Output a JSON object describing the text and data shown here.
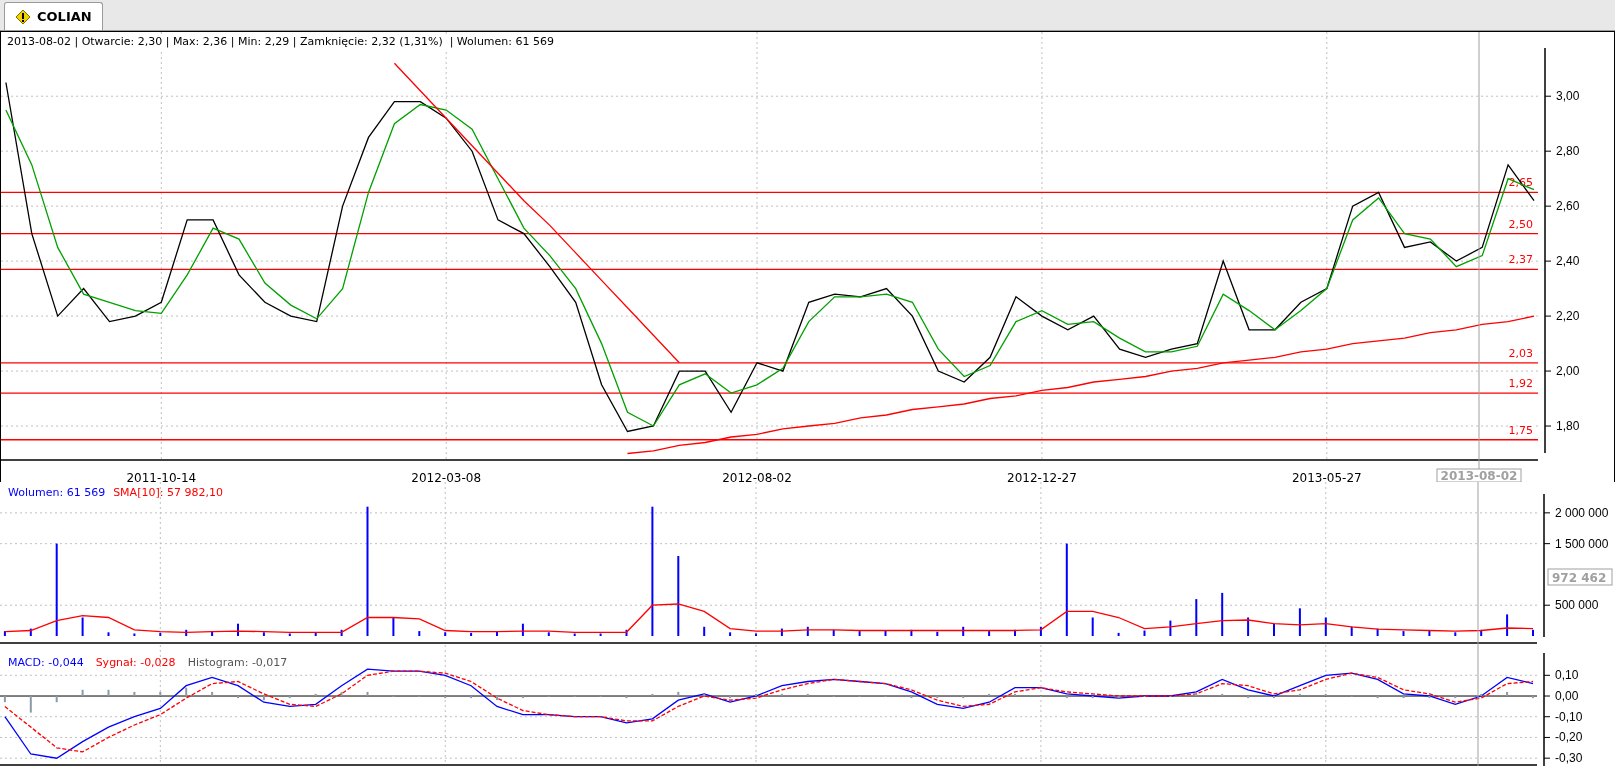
{
  "tab": {
    "label": "COLIAN",
    "selected": true
  },
  "info_line": "2013-08-02 | Otwarcie: 2,30 | Max: 2,36 | Min: 2,29 | Zamknięcie: 2,32 (1,31%)  | Wolumen: 61 569",
  "cursor": {
    "date_label": "2013-08-02",
    "volume_label": "972 462"
  },
  "price_chart": {
    "chart_data": {
      "type": "line",
      "grid": true,
      "categories": [
        null,
        null,
        null,
        null,
        null,
        null,
        "2011-10-14",
        null,
        null,
        null,
        null,
        null,
        null,
        null,
        null,
        null,
        null,
        "2012-03-08",
        null,
        null,
        null,
        null,
        null,
        null,
        null,
        null,
        null,
        null,
        null,
        "2012-08-02",
        null,
        null,
        null,
        null,
        null,
        null,
        null,
        null,
        null,
        null,
        "2012-12-27",
        null,
        null,
        null,
        null,
        null,
        null,
        null,
        null,
        null,
        null,
        "2013-05-27",
        null,
        null,
        null,
        null,
        null,
        null,
        null,
        null
      ],
      "ylim": [
        1.68,
        3.23
      ],
      "yticks": [
        {
          "value": 1.8,
          "label": "1,80"
        },
        {
          "value": 2.0,
          "label": "2,00"
        },
        {
          "value": 2.2,
          "label": "2,20"
        },
        {
          "value": 2.4,
          "label": "2,40"
        },
        {
          "value": 2.6,
          "label": "2,60"
        },
        {
          "value": 2.8,
          "label": "2,80"
        },
        {
          "value": 3.0,
          "label": "3,00"
        }
      ],
      "series": [
        {
          "color": "#000000",
          "values": [
            3.05,
            2.5,
            2.2,
            2.3,
            2.18,
            2.2,
            2.25,
            2.55,
            2.55,
            2.35,
            2.25,
            2.2,
            2.18,
            2.6,
            2.85,
            2.98,
            2.98,
            2.92,
            2.8,
            2.55,
            2.5,
            2.38,
            2.25,
            1.95,
            1.78,
            1.8,
            2.0,
            2.0,
            1.85,
            2.03,
            2.0,
            2.25,
            2.28,
            2.27,
            2.3,
            2.2,
            2.0,
            1.96,
            2.05,
            2.27,
            2.2,
            2.15,
            2.2,
            2.08,
            2.05,
            2.08,
            2.1,
            2.4,
            2.15,
            2.15,
            2.25,
            2.3,
            2.6,
            2.65,
            2.45,
            2.47,
            2.4,
            2.45,
            2.75,
            2.62
          ]
        },
        {
          "color": "#00a000",
          "values": [
            2.95,
            2.75,
            2.45,
            2.28,
            2.25,
            2.22,
            2.21,
            2.35,
            2.52,
            2.48,
            2.32,
            2.24,
            2.19,
            2.3,
            2.65,
            2.9,
            2.97,
            2.95,
            2.88,
            2.7,
            2.52,
            2.42,
            2.3,
            2.1,
            1.85,
            1.8,
            1.95,
            1.99,
            1.92,
            1.95,
            2.01,
            2.18,
            2.27,
            2.27,
            2.28,
            2.25,
            2.08,
            1.98,
            2.02,
            2.18,
            2.22,
            2.17,
            2.18,
            2.12,
            2.07,
            2.07,
            2.09,
            2.28,
            2.22,
            2.15,
            2.22,
            2.3,
            2.55,
            2.63,
            2.5,
            2.48,
            2.38,
            2.42,
            2.7,
            2.66
          ]
        },
        {
          "color": "#ff0000",
          "values": [
            null,
            null,
            null,
            null,
            null,
            null,
            null,
            null,
            null,
            null,
            null,
            null,
            null,
            null,
            null,
            3.12,
            3.02,
            2.92,
            2.82,
            2.72,
            2.62,
            2.53,
            2.43,
            2.33,
            2.23,
            2.13,
            2.03,
            null,
            null,
            null,
            null,
            null,
            null,
            null,
            null,
            null,
            null,
            null,
            null,
            null,
            null,
            null,
            null,
            null,
            null,
            null,
            null,
            null,
            null,
            null,
            null,
            null,
            null,
            null,
            null,
            null,
            null,
            null,
            null,
            null
          ]
        },
        {
          "color": "#ff0000",
          "values": [
            null,
            null,
            null,
            null,
            null,
            null,
            null,
            null,
            null,
            null,
            null,
            null,
            null,
            null,
            null,
            null,
            null,
            null,
            null,
            null,
            null,
            null,
            null,
            null,
            1.7,
            1.71,
            1.73,
            1.74,
            1.76,
            1.77,
            1.79,
            1.8,
            1.81,
            1.83,
            1.84,
            1.86,
            1.87,
            1.88,
            1.9,
            1.91,
            1.93,
            1.94,
            1.96,
            1.97,
            1.98,
            2.0,
            2.01,
            2.03,
            2.04,
            2.05,
            2.07,
            2.08,
            2.1,
            2.11,
            2.12,
            2.14,
            2.15,
            2.17,
            2.18,
            2.2
          ]
        }
      ],
      "ref_lines": [
        {
          "axis": "y",
          "value": 2.65,
          "label": "2,65"
        },
        {
          "axis": "y",
          "value": 2.5,
          "label": "2,50"
        },
        {
          "axis": "y",
          "value": 2.37,
          "label": "2,37"
        },
        {
          "axis": "y",
          "value": 2.03,
          "label": "2,03"
        },
        {
          "axis": "y",
          "value": 1.92,
          "label": "1,92"
        },
        {
          "axis": "y",
          "value": 1.75,
          "label": "1,75"
        }
      ]
    }
  },
  "volume_chart": {
    "legend": [
      {
        "text": "Wolumen: 61 569",
        "color": "#0000ff"
      },
      {
        "text": "SMA[10]: 57 982,10",
        "color": "#ff0000"
      }
    ],
    "chart_data": {
      "type": "bar",
      "grid": true,
      "ylim": [
        0,
        2290000
      ],
      "categories": [
        null,
        null,
        null,
        null,
        null,
        null,
        null,
        null,
        null,
        null,
        null,
        null,
        null,
        null,
        null,
        null,
        null,
        null,
        null,
        null,
        null,
        null,
        null,
        null,
        null,
        null,
        null,
        null,
        null,
        null,
        null,
        null,
        null,
        null,
        null,
        null,
        null,
        null,
        null,
        null,
        null,
        null,
        null,
        null,
        null,
        null,
        null,
        null,
        null,
        null,
        null,
        null,
        null,
        null,
        null,
        null,
        null,
        null,
        null,
        null
      ],
      "yticks": [
        {
          "value": 500000,
          "label": "500 000"
        },
        {
          "value": 1500000,
          "label": "1 500 000"
        },
        {
          "value": 2000000,
          "label": "2 000 000"
        }
      ],
      "series": [
        {
          "color": "#0000ff",
          "values": [
            80000,
            120000,
            1500000,
            300000,
            60000,
            40000,
            50000,
            100000,
            70000,
            200000,
            60000,
            40000,
            50000,
            100000,
            2100000,
            300000,
            80000,
            60000,
            50000,
            70000,
            200000,
            60000,
            40000,
            40000,
            100000,
            2100000,
            1300000,
            150000,
            60000,
            40000,
            120000,
            150000,
            100000,
            80000,
            90000,
            100000,
            70000,
            150000,
            80000,
            100000,
            150000,
            1500000,
            300000,
            50000,
            90000,
            250000,
            600000,
            700000,
            300000,
            200000,
            450000,
            300000,
            150000,
            120000,
            80000,
            90000,
            60000,
            100000,
            350000,
            100000
          ]
        },
        {
          "type": "line",
          "color": "#ff0000",
          "values": [
            70000,
            90000,
            250000,
            330000,
            300000,
            100000,
            70000,
            60000,
            70000,
            80000,
            70000,
            60000,
            60000,
            60000,
            300000,
            300000,
            280000,
            90000,
            70000,
            70000,
            80000,
            80000,
            60000,
            60000,
            60000,
            500000,
            520000,
            400000,
            120000,
            80000,
            80000,
            100000,
            100000,
            90000,
            90000,
            90000,
            90000,
            90000,
            90000,
            90000,
            100000,
            400000,
            400000,
            300000,
            120000,
            150000,
            200000,
            250000,
            260000,
            200000,
            180000,
            200000,
            150000,
            110000,
            100000,
            90000,
            80000,
            90000,
            130000,
            120000
          ]
        }
      ]
    }
  },
  "macd_chart": {
    "legend": [
      {
        "text": "MACD: -0,044",
        "color": "#0000ff"
      },
      {
        "text": "Sygnał: -0,028",
        "color": "#ff0000"
      },
      {
        "text": "Histogram: -0,017",
        "color": "#555555"
      }
    ],
    "chart_data": {
      "type": "line",
      "grid": true,
      "ylim": [
        -0.333,
        0.198
      ],
      "categories": [
        null,
        null,
        null,
        null,
        null,
        null,
        null,
        null,
        null,
        null,
        null,
        null,
        null,
        null,
        null,
        null,
        null,
        null,
        null,
        null,
        null,
        null,
        null,
        null,
        null,
        null,
        null,
        null,
        null,
        null,
        null,
        null,
        null,
        null,
        null,
        null,
        null,
        null,
        null,
        null,
        null,
        null,
        null,
        null,
        null,
        null,
        null,
        null,
        null,
        null,
        null,
        null,
        null,
        null,
        null,
        null,
        null,
        null,
        null,
        null
      ],
      "yticks": [
        {
          "value": -0.3,
          "label": "-0,30"
        },
        {
          "value": -0.2,
          "label": "-0,20"
        },
        {
          "value": -0.1,
          "label": "-0,10"
        },
        {
          "value": 0,
          "label": "0,00"
        },
        {
          "value": 0.1,
          "label": "0,10"
        }
      ],
      "series": [
        {
          "color": "#0000ff",
          "line_style": "solid",
          "values": [
            -0.1,
            -0.28,
            -0.3,
            -0.22,
            -0.15,
            -0.1,
            -0.06,
            0.05,
            0.09,
            0.05,
            -0.03,
            -0.05,
            -0.04,
            0.05,
            0.13,
            0.12,
            0.12,
            0.1,
            0.05,
            -0.05,
            -0.09,
            -0.09,
            -0.1,
            -0.1,
            -0.13,
            -0.11,
            -0.02,
            0.01,
            -0.03,
            0.0,
            0.05,
            0.07,
            0.08,
            0.07,
            0.06,
            0.02,
            -0.04,
            -0.06,
            -0.03,
            0.04,
            0.04,
            0.01,
            0.0,
            -0.01,
            0.0,
            0.0,
            0.02,
            0.08,
            0.03,
            0.0,
            0.05,
            0.1,
            0.11,
            0.08,
            0.01,
            0.0,
            -0.04,
            0.0,
            0.09,
            0.06
          ]
        },
        {
          "color": "#ff0000",
          "line_style": "dashed",
          "values": [
            -0.05,
            -0.15,
            -0.25,
            -0.27,
            -0.2,
            -0.14,
            -0.09,
            -0.01,
            0.06,
            0.07,
            0.01,
            -0.04,
            -0.05,
            0.01,
            0.1,
            0.12,
            0.12,
            0.11,
            0.07,
            -0.01,
            -0.07,
            -0.09,
            -0.1,
            -0.1,
            -0.12,
            -0.12,
            -0.05,
            0.0,
            -0.02,
            -0.01,
            0.03,
            0.06,
            0.08,
            0.07,
            0.06,
            0.03,
            -0.02,
            -0.05,
            -0.04,
            0.02,
            0.04,
            0.02,
            0.01,
            0.0,
            0.0,
            0.0,
            0.01,
            0.06,
            0.05,
            0.01,
            0.03,
            0.08,
            0.11,
            0.09,
            0.03,
            0.01,
            -0.03,
            -0.01,
            0.06,
            0.07
          ]
        },
        {
          "type": "bar",
          "color": "#8a9aa6",
          "values": [
            -0.03,
            -0.08,
            -0.03,
            0.03,
            0.03,
            0.02,
            0.02,
            0.04,
            0.02,
            -0.01,
            -0.02,
            -0.01,
            0.01,
            0.02,
            0.02,
            0.0,
            0.0,
            -0.01,
            -0.01,
            -0.02,
            -0.01,
            0.0,
            0.0,
            0.0,
            -0.01,
            0.01,
            0.02,
            0.01,
            -0.01,
            0.01,
            0.01,
            0.01,
            0.0,
            0.0,
            0.0,
            -0.01,
            -0.01,
            -0.01,
            0.01,
            0.01,
            0.0,
            -0.01,
            -0.01,
            -0.01,
            0.0,
            0.0,
            0.01,
            0.01,
            -0.01,
            -0.01,
            0.01,
            0.01,
            0.0,
            -0.01,
            -0.01,
            -0.01,
            -0.01,
            0.01,
            0.02,
            -0.01
          ]
        }
      ]
    }
  }
}
